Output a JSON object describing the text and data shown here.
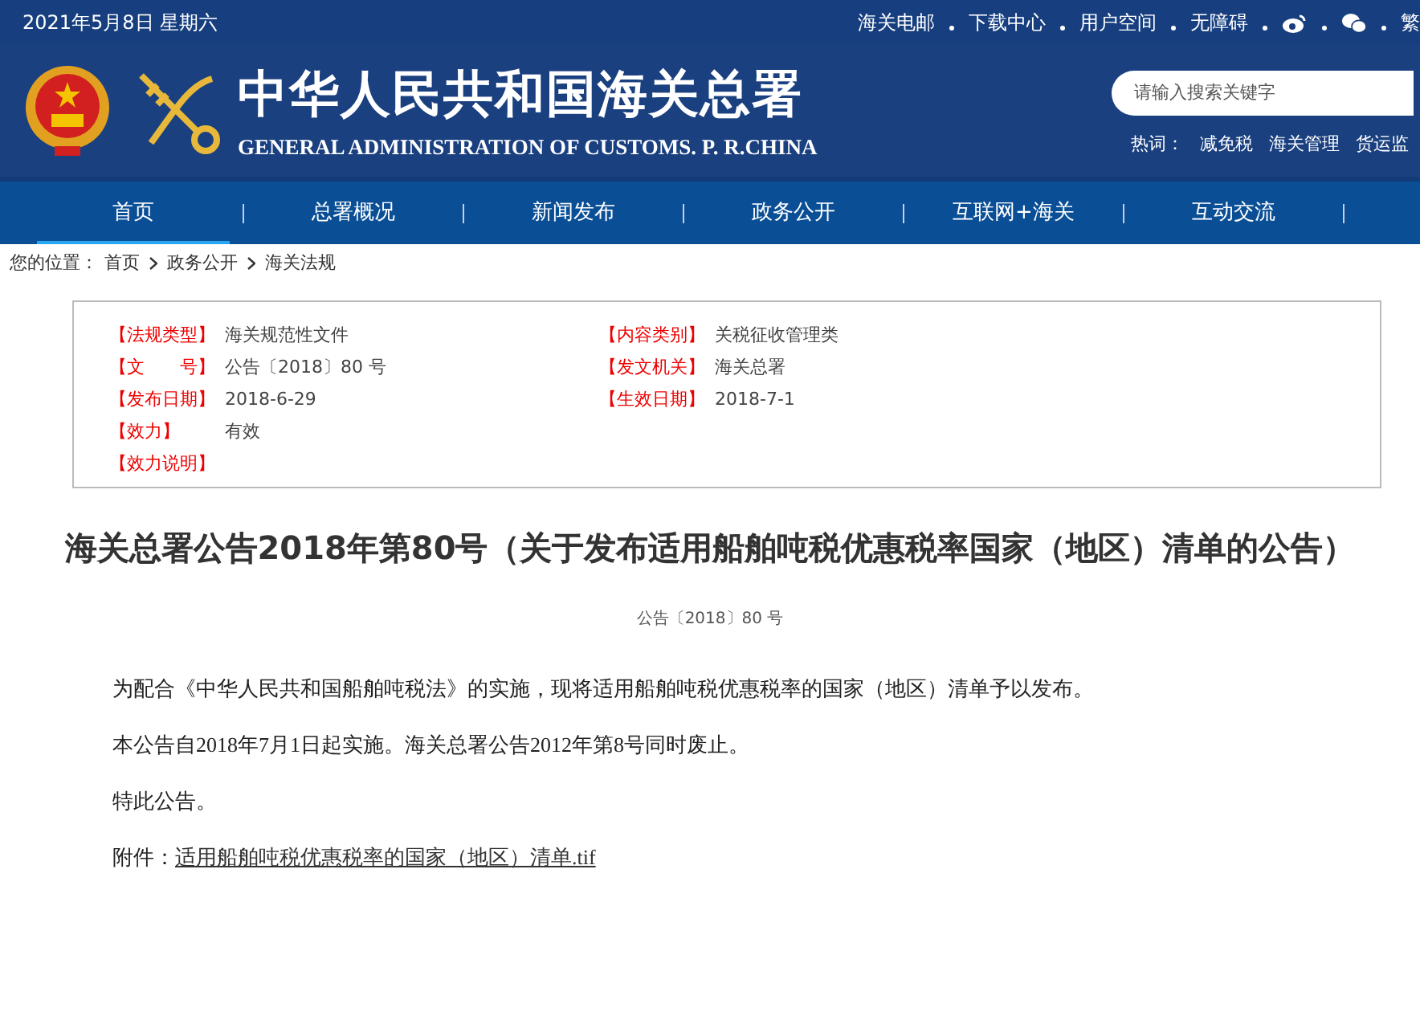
{
  "top_bar": {
    "date": "2021年5月8日 星期六",
    "links": [
      "海关电邮",
      "下载中心",
      "用户空间",
      "无障碍"
    ],
    "language": "繁"
  },
  "header": {
    "title": "中华人民共和国海关总署",
    "subtitle": "GENERAL ADMINISTRATION OF CUSTOMS. P. R.CHINA",
    "search": {
      "placeholder": "请输入搜索关键字"
    },
    "hot_label": "热词：",
    "hot_words": [
      "减免税",
      "海关管理",
      "货运监"
    ]
  },
  "nav": [
    {
      "label": "首页",
      "selected": true
    },
    {
      "label": "总署概况",
      "selected": false
    },
    {
      "label": "新闻发布",
      "selected": false
    },
    {
      "label": "政务公开",
      "selected": false
    },
    {
      "label": "互联网+海关",
      "selected": false
    },
    {
      "label": "互动交流",
      "selected": false
    }
  ],
  "breadcrumb": {
    "label": "您的位置：",
    "items": [
      "首页",
      "政务公开",
      "海关法规"
    ]
  },
  "info": [
    {
      "label": "【法规类型】",
      "value": "海关规范性文件"
    },
    {
      "label": "【内容类别】",
      "value": "关税征收管理类"
    },
    {
      "label": "【文　　号】",
      "value": "公告〔2018〕80 号"
    },
    {
      "label": "【发文机关】",
      "value": "海关总署"
    },
    {
      "label": "【发布日期】",
      "value": "2018-6-29"
    },
    {
      "label": "【生效日期】",
      "value": "2018-7-1"
    },
    {
      "label": "【效力】",
      "value": "有效"
    },
    {
      "label": "【效力说明】"
    }
  ],
  "article": {
    "title": "海关总署公告2018年第80号（关于发布适用船舶吨税优惠税率国家（地区）清单的公告）",
    "doc_number": "公告〔2018〕80 号",
    "paragraphs": [
      "为配合《中华人民共和国船舶吨税法》的实施，现将适用船舶吨税优惠税率的国家（地区）清单予以发布。",
      "本公告自2018年7月1日起实施。海关总署公告2012年第8号同时废止。",
      "特此公告。"
    ],
    "attachment": {
      "label": "附件：",
      "link": "适用船舶吨税优惠税率的国家（地区）清单.tif"
    }
  }
}
